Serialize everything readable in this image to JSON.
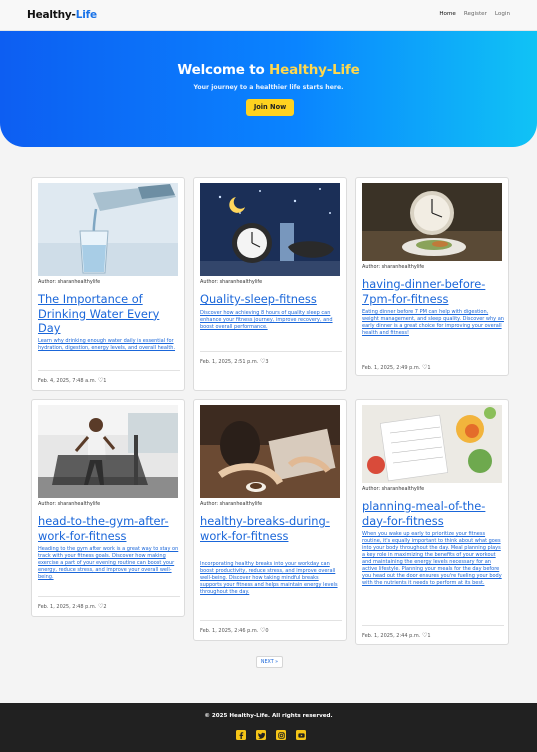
{
  "nav": {
    "brand_left": "Healthy-",
    "brand_right": "Life",
    "links": [
      "Home",
      "Register",
      "Login"
    ]
  },
  "hero": {
    "title_prefix": "Welcome to ",
    "title_accent": "Healthy-Life",
    "subtitle": "Your journey to a healthier life starts here.",
    "button": "Join Now"
  },
  "posts": [
    {
      "author": "Author: sharanhealthylife",
      "title": "The Importance of Drinking Water Every Day",
      "description": "Learn why drinking enough water daily is essential for hydration, digestion, energy levels, and overall health.",
      "date": "Feb. 4, 2025, 7:48 a.m.",
      "likes": "1",
      "image": "water-glass-image"
    },
    {
      "author": "Author: sharanhealthylife",
      "title": "Quality-sleep-fitness",
      "description": "Discover how achieving 8 hours of quality sleep can enhance your fitness journey, improve recovery, and boost overall performance.",
      "date": "Feb. 1, 2025, 2:51 p.m.",
      "likes": "3",
      "image": "sleep-alarm-clock-image"
    },
    {
      "author": "Author: sharanhealthylife",
      "title": "having-dinner-before-7pm-for-fitness",
      "description": "Eating dinner before 7 PM can help with digestion, weight management, and sleep quality. Discover why an early dinner is a great choice for improving your overall health and fitness!",
      "date": "Feb. 1, 2025, 2:49 p.m.",
      "likes": "1",
      "image": "dinner-clock-plate-image"
    },
    {
      "author": "Author: sharanhealthylife",
      "title": "head-to-the-gym-after-work-for-fitness",
      "description": "Heading to the gym after work is a great way to stay on track with your fitness goals. Discover how making exercise a part of your evening routine can boost your energy, reduce stress, and improve your overall well-being.",
      "date": "Feb. 1, 2025, 2:48 p.m.",
      "likes": "2",
      "image": "gym-treadmill-image"
    },
    {
      "author": "Author: sharanhealthylife",
      "title": "healthy-breaks-during-work-for-fitness",
      "description": "Incorporating healthy breaks into your workday can boost productivity, reduce stress, and improve overall well-being. Discover how taking mindful breaks supports your fitness and helps maintain energy levels throughout the day.",
      "date": "Feb. 1, 2025, 2:46 p.m.",
      "likes": "0",
      "image": "work-break-coffee-image"
    },
    {
      "author": "Author: sharanhealthylife",
      "title": "planning-meal-of-the-day-for-fitness",
      "description": "When you wake up early to prioritize your fitness routine, it's equally important to think about what goes into your body throughout the day. Meal planning plays a key role in maximizing the benefits of your workout and maintaining the energy levels necessary for an active lifestyle. Planning your meals for the day before you head out the door ensures you're fueling your body with the nutrients it needs to perform at its best.",
      "date": "Feb. 1, 2025, 2:44 p.m.",
      "likes": "1",
      "image": "meal-planner-image"
    }
  ],
  "pagination": {
    "next": "NEXT »"
  },
  "footer": {
    "copyright": "© 2025 Healthy-Life. All rights reserved.",
    "socials": [
      "facebook-icon",
      "twitter-icon",
      "instagram-icon",
      "youtube-icon"
    ]
  },
  "colors": {
    "brand_blue": "#1a73e8",
    "hero_start": "#0d5ef2",
    "hero_end": "#10c3f5",
    "accent_yellow": "#ffd21f",
    "link_blue": "#1a66d9",
    "footer_bg": "#212121"
  }
}
